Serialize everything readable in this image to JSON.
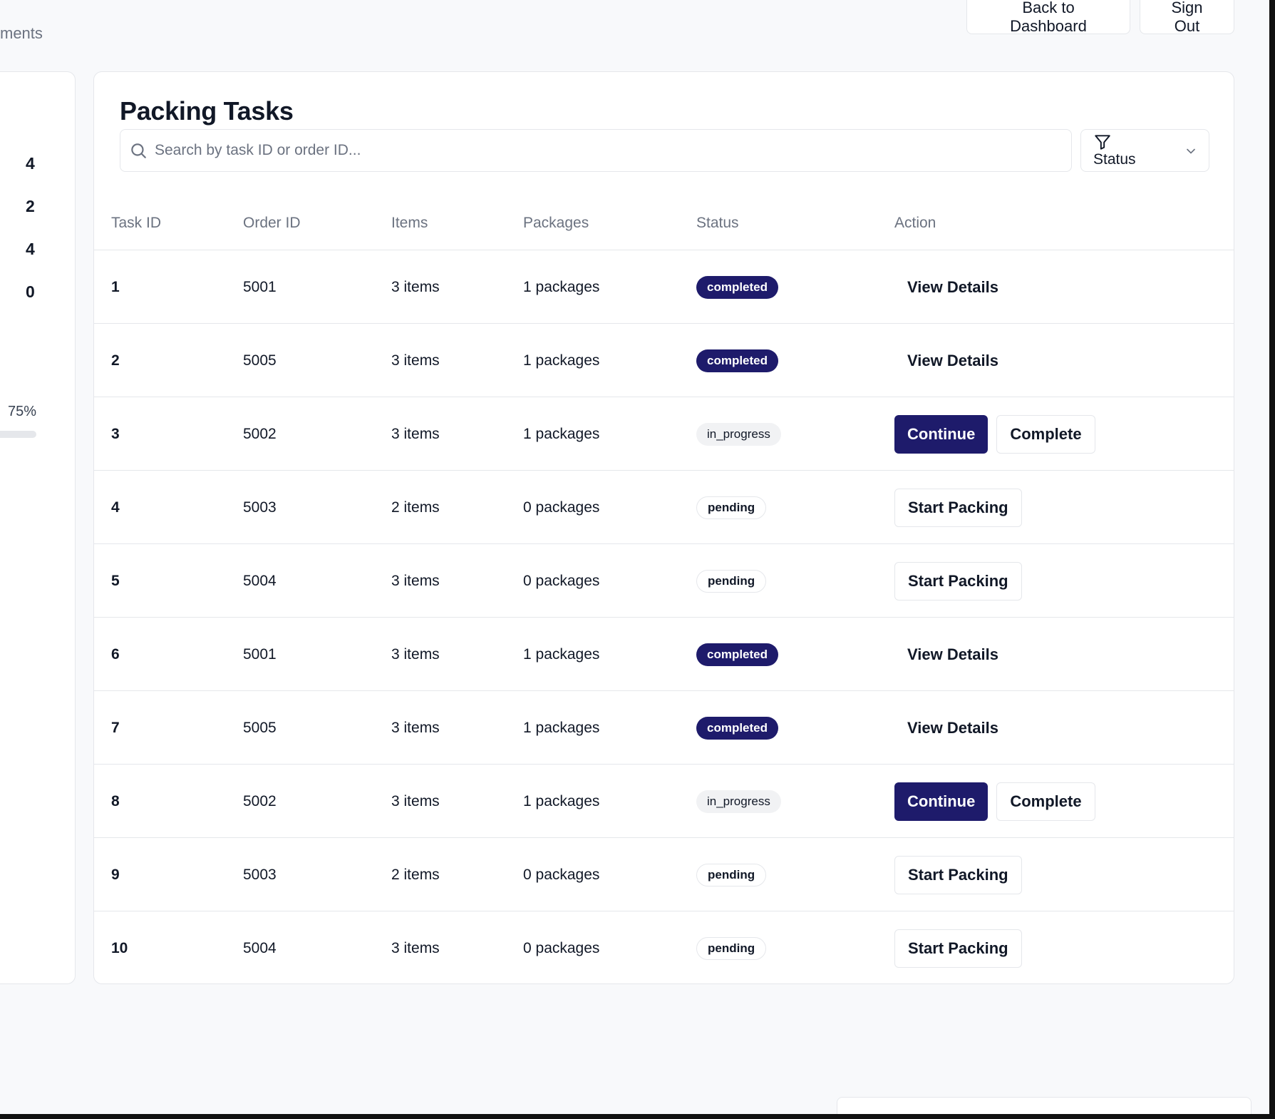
{
  "header": {
    "subtitle": "ments",
    "back_button": "Back to Dashboard",
    "signout_button": "Sign Out"
  },
  "stats": {
    "values": [
      "4",
      "2",
      "4",
      "0"
    ],
    "progress_label": "75%",
    "progress_fraction": 0.75
  },
  "main": {
    "title": "Packing Tasks",
    "search": {
      "placeholder": "Search by task ID or order ID...",
      "value": ""
    },
    "status_filter": {
      "label": "Status"
    },
    "columns": [
      "Task ID",
      "Order ID",
      "Items",
      "Packages",
      "Status",
      "Action"
    ],
    "rows": [
      {
        "task_id": "1",
        "order_id": "5001",
        "items": "3 items",
        "packages": "1 packages",
        "status": "completed",
        "actions": [
          "View Details"
        ]
      },
      {
        "task_id": "2",
        "order_id": "5005",
        "items": "3 items",
        "packages": "1 packages",
        "status": "completed",
        "actions": [
          "View Details"
        ]
      },
      {
        "task_id": "3",
        "order_id": "5002",
        "items": "3 items",
        "packages": "1 packages",
        "status": "in_progress",
        "actions": [
          "Continue",
          "Complete"
        ]
      },
      {
        "task_id": "4",
        "order_id": "5003",
        "items": "2 items",
        "packages": "0 packages",
        "status": "pending",
        "actions": [
          "Start Packing"
        ]
      },
      {
        "task_id": "5",
        "order_id": "5004",
        "items": "3 items",
        "packages": "0 packages",
        "status": "pending",
        "actions": [
          "Start Packing"
        ]
      },
      {
        "task_id": "6",
        "order_id": "5001",
        "items": "3 items",
        "packages": "1 packages",
        "status": "completed",
        "actions": [
          "View Details"
        ]
      },
      {
        "task_id": "7",
        "order_id": "5005",
        "items": "3 items",
        "packages": "1 packages",
        "status": "completed",
        "actions": [
          "View Details"
        ]
      },
      {
        "task_id": "8",
        "order_id": "5002",
        "items": "3 items",
        "packages": "1 packages",
        "status": "in_progress",
        "actions": [
          "Continue",
          "Complete"
        ]
      },
      {
        "task_id": "9",
        "order_id": "5003",
        "items": "2 items",
        "packages": "0 packages",
        "status": "pending",
        "actions": [
          "Start Packing"
        ]
      },
      {
        "task_id": "10",
        "order_id": "5004",
        "items": "3 items",
        "packages": "0 packages",
        "status": "pending",
        "actions": [
          "Start Packing"
        ]
      }
    ]
  },
  "colors": {
    "primary": "#1e1b6b",
    "border": "#e5e7eb",
    "muted_text": "#6b7280",
    "background": "#f8f9fb"
  }
}
